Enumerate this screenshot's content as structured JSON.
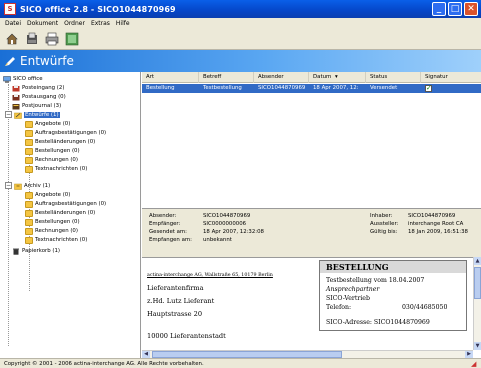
{
  "window": {
    "title": "SICO office 2.8 - SICO1044870969",
    "app_icon_glyph": "S",
    "buttons": {
      "minimize": "_",
      "maximize": "□",
      "close": "✕"
    }
  },
  "menu": [
    "Datei",
    "Dokument",
    "Ordner",
    "Extras",
    "Hilfe"
  ],
  "toolbar": {
    "icons": [
      "home-icon",
      "inbox-icon",
      "print-icon",
      "archive-icon"
    ]
  },
  "banner": {
    "title": "Entwürfe",
    "icon": "pen-icon"
  },
  "tree": {
    "root": "SICO office",
    "items": [
      {
        "label": "Posteingang (2)",
        "icon": "inbox-icon"
      },
      {
        "label": "Postausgang (0)",
        "icon": "outbox-icon"
      },
      {
        "label": "Postjournal (3)",
        "icon": "journal-icon"
      },
      {
        "label": "Entwürfe (1)",
        "icon": "drafts-icon",
        "selected": true
      },
      {
        "label": "Angebote (0)"
      },
      {
        "label": "Auftragsbestätigungen (0)"
      },
      {
        "label": "Bestelländerungen (0)"
      },
      {
        "label": "Bestellungen (0)"
      },
      {
        "label": "Rechnungen (0)"
      },
      {
        "label": "Textnachrichten (0)"
      },
      {
        "label": "Archiv (1)",
        "icon": "archive-icon"
      },
      {
        "label": "Angebote (0)"
      },
      {
        "label": "Auftragsbestätigungen (0)"
      },
      {
        "label": "Bestelländerungen (0)"
      },
      {
        "label": "Bestellungen (0)"
      },
      {
        "label": "Rechnungen (0)"
      },
      {
        "label": "Textnachrichten (0)"
      },
      {
        "label": "Papierkorb (1)",
        "icon": "trash-icon"
      }
    ],
    "expander_glyph": "−"
  },
  "list": {
    "columns": [
      "Art",
      "Betreff",
      "Absender",
      "Datum",
      "Status",
      "Signatur"
    ],
    "sort_glyph": "▾",
    "rows": [
      {
        "art": "Bestellung",
        "betreff": "Testbestellung",
        "absender": "SICO1044870969",
        "datum": "18 Apr 2007, 12:",
        "status": "Versendet",
        "signatur": "✓"
      }
    ]
  },
  "meta": {
    "left": [
      {
        "label": "Absender:",
        "value": "SICO1044870969"
      },
      {
        "label": "Empfänger:",
        "value": "SIC0000000006"
      },
      {
        "label": "Gesendet am:",
        "value": "18 Apr 2007, 12:32:08"
      },
      {
        "label": "Empfangen am:",
        "value": "unbekannt"
      }
    ],
    "right": [
      {
        "label": "Inhaber:",
        "value": "SICO1044870969"
      },
      {
        "label": "Aussteller:",
        "value": "interchange Root CA"
      },
      {
        "label": "Gültig bis:",
        "value": "18 Jan 2009, 16:51:38"
      }
    ]
  },
  "preview": {
    "sender_line": "actina-interchange AG, Wallstraße 65, 10179 Berlin",
    "address": [
      "Lieferantenfirma",
      "z.Hd. Lutz Lieferant",
      "Hauptstrasse 20",
      "10000 Lieferantenstadt"
    ],
    "box": {
      "heading": "BESTELLUNG",
      "line1": "Testbestellung vom 18.04.2007",
      "line2": "Ansprechpartner",
      "line3": "SICO-Vertrieb",
      "phone_label": "Telefon:",
      "phone_value": "030/44685050",
      "address_line": "SICO-Adresse: SICO1044870969"
    }
  },
  "scroll": {
    "up": "▲",
    "down": "▼",
    "left": "◀",
    "right": "▶"
  },
  "statusbar": {
    "text": "Copyright © 2001 - 2006 actina-interchange AG. Alle Rechte vorbehalten.",
    "grip": "◢"
  },
  "colors": {
    "selection": "#316ac5",
    "titlebar": "#0546c8",
    "banner": "#1a6fd6",
    "folder": "#f4c542"
  }
}
